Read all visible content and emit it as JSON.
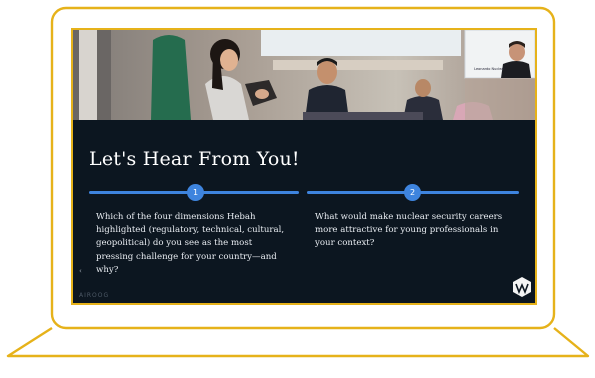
{
  "slide": {
    "title": "Let's Hear From You!",
    "steps": [
      {
        "number": "1",
        "question": "Which of the four dimensions Hebah highlighted (regulatory, technical, cultural, geopolitical) do you see as the most pressing challenge for your country—and why?"
      },
      {
        "number": "2",
        "question": "What would make nuclear security careers more attractive for young professionals in your context?"
      }
    ],
    "accent_color": "#3e84de",
    "background_color": "#0c1620",
    "edge_glyph": "‹",
    "footer_faint_text": "AIROOG"
  },
  "video": {
    "participant_label": "Leonardo Nuclear"
  },
  "laptop": {
    "frame_color": "#e6b21a"
  },
  "icons": [
    "camera-thumbnail",
    "logo-icon"
  ]
}
